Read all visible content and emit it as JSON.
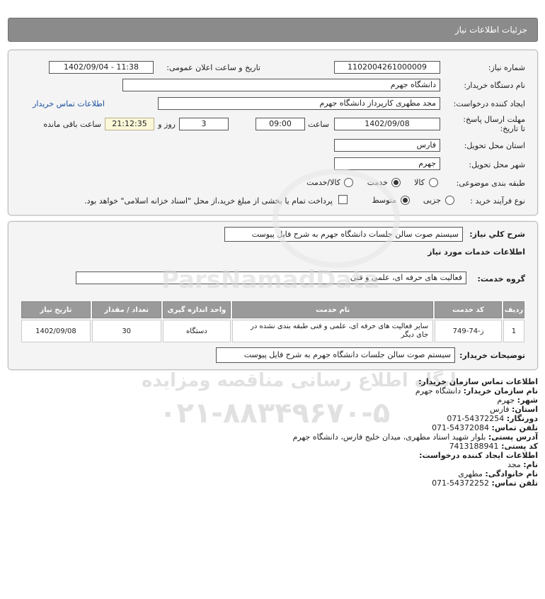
{
  "header": {
    "title": "جزئیات اطلاعات نیاز"
  },
  "fields": {
    "need_number_label": "شماره نیاز:",
    "need_number": "1102004261000009",
    "announce_label": "تاریخ و ساعت اعلان عمومی:",
    "announce_value": "1402/09/04 - 11:38",
    "buyer_org_label": "نام دستگاه خریدار:",
    "buyer_org": "دانشگاه جهرم",
    "creator_label": "ایجاد کننده درخواست:",
    "creator": "مجد مطهری کارپرداز دانشگاه جهرم",
    "contact_link": "اطلاعات تماس خریدار",
    "deadline_label": "مهلت ارسال پاسخ: تا تاریخ:",
    "deadline_date": "1402/09/08",
    "time_label": "ساعت",
    "deadline_time": "09:00",
    "days_value": "3",
    "days_label": "روز و",
    "remaining_time": "21:12:35",
    "remaining_label": "ساعت باقی مانده",
    "province_label": "استان محل تحویل:",
    "province": "فارس",
    "city_label": "شهر محل تحویل:",
    "city": "جهرم",
    "category_label": "طبقه بندی موضوعی:",
    "category_options": [
      "کالا",
      "خدمت",
      "کالا/خدمت"
    ],
    "category_selected": "خدمت",
    "process_label": "نوع فرآیند خرید :",
    "process_options": [
      "جزیی",
      "متوسط"
    ],
    "process_selected": "متوسط",
    "payment_note": "پرداخت تمام یا بخشی از مبلغ خرید،از محل \"اسناد خزانه اسلامی\" خواهد بود."
  },
  "general": {
    "desc_label": "شرح کلي نياز:",
    "desc_value": "سیستم صوت سالن جلسات دانشگاه جهرم به شرح فایل پیوست",
    "services_heading": "اطلاعات خدمات مورد نیاز",
    "group_label": "گروه خدمت:",
    "group_value": "فعالیت های حرفه ای، علمی و فنی"
  },
  "table": {
    "headers": [
      "ردیف",
      "کد خدمت",
      "نام خدمت",
      "واحد اندازه گیری",
      "تعداد / مقدار",
      "تاریخ نیاز"
    ],
    "rows": [
      [
        "1",
        "ز-74-749",
        "سایر فعالیت های حرفه ای، علمی و فنی طبقه بندی نشده در جای دیگر",
        "دستگاه",
        "30",
        "1402/09/08"
      ]
    ]
  },
  "notes": {
    "label": "توضیحات خریدار:",
    "value": "سیستم صوت سالن جلسات دانشگاه جهرم به شرح فایل پیوست"
  },
  "buyer_info": {
    "heading": "اطلاعات تماس سازمان خریدار:",
    "org_label": "نام سازمان خریدار:",
    "org": "دانشگاه جهرم",
    "city_label": "شهر:",
    "city": "جهرم",
    "province_label": "استان:",
    "province": "فارس",
    "fax_label": "دورنگار:",
    "fax": "071-54372254",
    "phone_label": "تلفن تماس:",
    "phone": "071-54372084",
    "address_label": "آدرس پستی:",
    "address": "بلوار شهید استاد مطهری، میدان خلیج فارس، دانشگاه جهرم",
    "postal_label": "کد پستی:",
    "postal": "7413188941"
  },
  "requester_info": {
    "heading": "اطلاعات ایجاد کننده درخواست:",
    "name_label": "نام:",
    "name": "مجد",
    "family_label": "نام خانوادگی:",
    "family": "مطهری",
    "phone_label": "تلفن تماس:",
    "phone": "071-54372252"
  },
  "watermark": {
    "line1": "ParsNamadData",
    "line2": "پایگاه اطلاع رسانی مناقصه ومزایده",
    "line3": "۰۲۱-۸۸۳۴۹۶۷۰-۵"
  }
}
